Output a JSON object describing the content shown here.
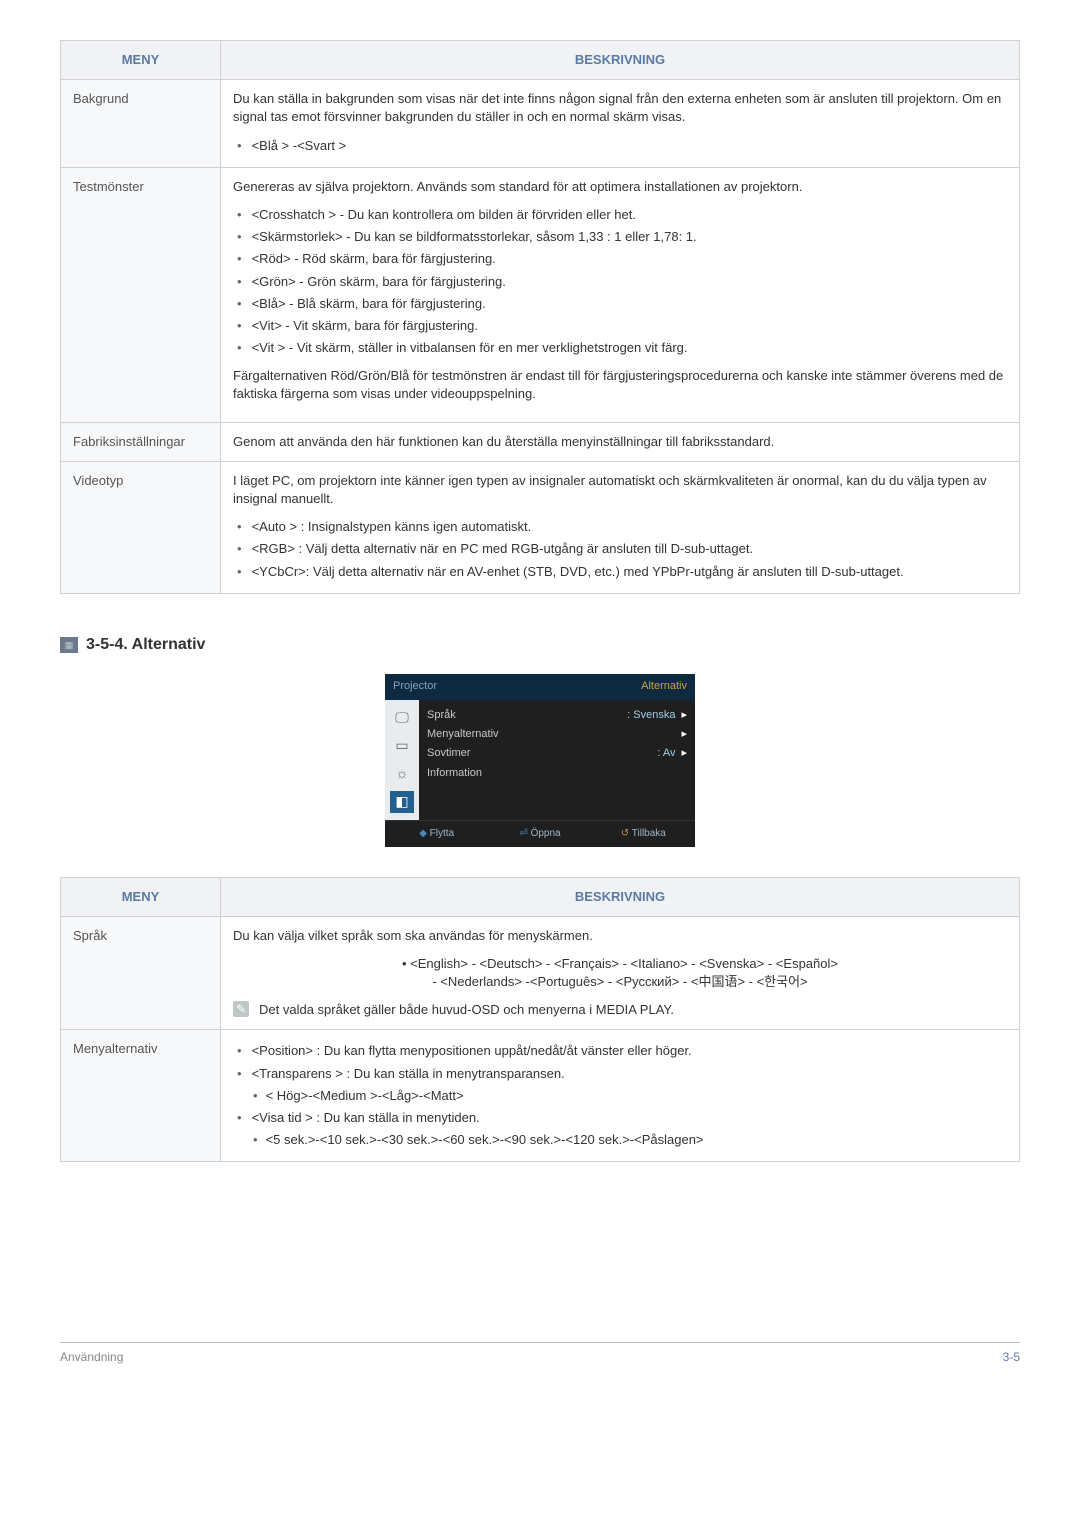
{
  "table1": {
    "head_menu": "MENY",
    "head_desc": "BESKRIVNING",
    "rows": {
      "bakgrund": {
        "label": "Bakgrund",
        "desc": "Du kan ställa in bakgrunden som visas när det inte finns någon signal från den externa enheten som är ansluten till projektorn. Om en signal tas emot försvinner bakgrunden du ställer in och en normal skärm visas.",
        "opt1": "<Blå > -<Svart >"
      },
      "testmonster": {
        "label": "Testmönster",
        "desc": "Genereras av själva projektorn. Används som standard för att optimera installationen av projektorn.",
        "o1": "<Crosshatch > - Du kan kontrollera om bilden är förvriden eller het.",
        "o2": "<Skärmstorlek> - Du kan se bildformatsstorlekar, såsom 1,33 : 1 eller 1,78: 1.",
        "o3": "<Röd> - Röd skärm, bara för färgjustering.",
        "o4": "<Grön> - Grön skärm, bara för färgjustering.",
        "o5": "<Blå> - Blå skärm, bara för färgjustering.",
        "o6": "<Vit> - Vit skärm, bara för färgjustering.",
        "o7": "<Vit > - Vit skärm, ställer in vitbalansen för en mer verklighetstrogen vit färg.",
        "foot": "Färgalternativen Röd/Grön/Blå för testmönstren är endast till för färgjusteringsprocedurerna och kanske inte stämmer överens med de faktiska färgerna som visas under videouppspelning."
      },
      "fabrik": {
        "label": "Fabriksinställningar",
        "desc": "Genom att använda den här funktionen kan du återställa menyinställningar till fabriksstandard."
      },
      "videotyp": {
        "label": "Videotyp",
        "desc": "I läget PC, om projektorn inte känner igen typen av insignaler automatiskt och skärmkvaliteten är onormal, kan du du välja typen av insignal manuellt.",
        "o1": "<Auto > : Insignalstypen känns igen automatiskt.",
        "o2": "<RGB> : Välj detta alternativ när en PC med RGB-utgång är ansluten till D-sub-uttaget.",
        "o3": "<YCbCr>: Välj detta alternativ när en AV-enhet (STB, DVD, etc.) med YPbPr-utgång är ansluten till D-sub-uttaget."
      }
    }
  },
  "section": {
    "num": "3-5-4.",
    "title": "Alternativ"
  },
  "osd": {
    "proj": "Projector",
    "tab": "Alternativ",
    "rows": {
      "r1l": "Språk",
      "r1v": ": Svenska",
      "r2l": "Menyalternativ",
      "r3l": "Sovtimer",
      "r3v": ": Av",
      "r4l": "Information"
    },
    "foot": {
      "f1": "Flytta",
      "f2": "Öppna",
      "f3": "Tillbaka"
    }
  },
  "table2": {
    "head_menu": "MENY",
    "head_desc": "BESKRIVNING",
    "rows": {
      "sprak": {
        "label": "Språk",
        "desc": "Du kan välja vilket språk som ska användas för menyskärmen.",
        "langs1": "<English> - <Deutsch> - <Français> - <Italiano> - <Svenska> - <Español>",
        "langs2": "- <Nederlands> -<Português> - <Русский>  -  <中国语>  -  <한국어>",
        "note": "Det valda språket gäller både huvud-OSD och menyerna i MEDIA PLAY."
      },
      "menyalt": {
        "label": "Menyalternativ",
        "o1": "<Position> : Du kan flytta menypositionen uppåt/nedåt/åt vänster eller höger.",
        "o2": "<Transparens > : Du kan ställa in menytransparansen.",
        "o2a": "< Hög>-<Medium >-<Låg>-<Matt>",
        "o3": "<Visa tid > : Du kan ställa in menytiden.",
        "o3a": "<5 sek.>-<10 sek.>-<30 sek.>-<60 sek.>-<90 sek.>-<120 sek.>-<Påslagen>"
      }
    }
  },
  "footer": {
    "left": "Användning",
    "right": "3-5"
  }
}
